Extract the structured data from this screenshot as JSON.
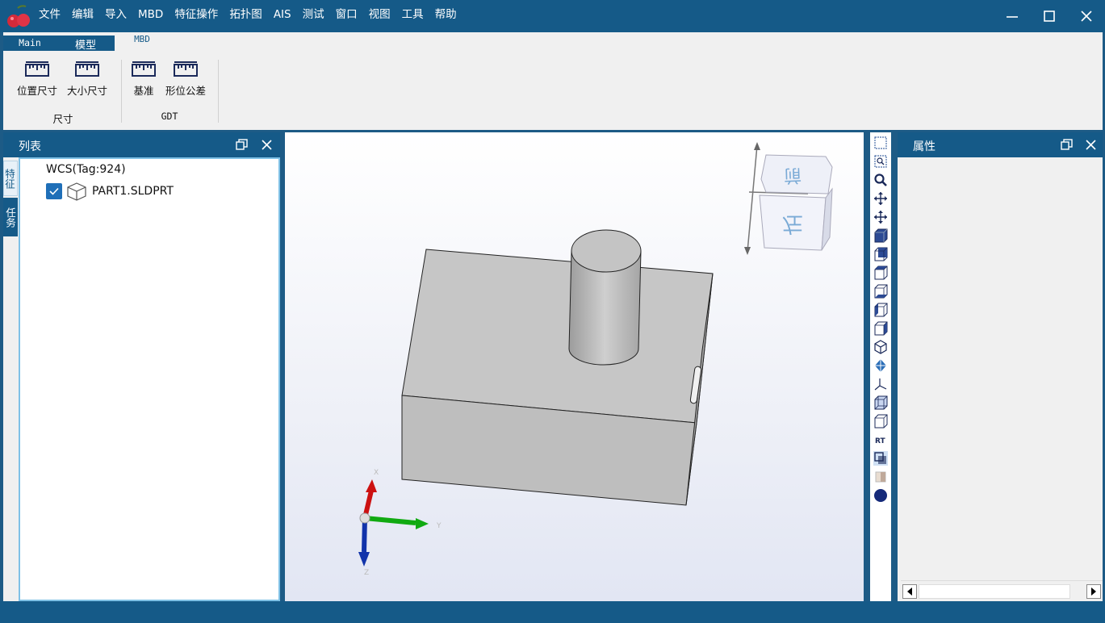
{
  "menu": [
    "文件",
    "编辑",
    "导入",
    "MBD",
    "特征操作",
    "拓扑图",
    "AIS",
    "测试",
    "窗口",
    "视图",
    "工具",
    "帮助"
  ],
  "tabs": {
    "main": "Main",
    "model": "模型",
    "mbd": "MBD"
  },
  "ribbon": {
    "buttons": [
      "位置尺寸",
      "大小尺寸",
      "基准",
      "形位公差"
    ],
    "groups": [
      "尺寸",
      "GDT"
    ]
  },
  "left_panel": {
    "title": "列表",
    "side_tabs": [
      "特征",
      "任务"
    ],
    "tree_root": "WCS(Tag:924)",
    "tree_item": "PART1.SLDPRT"
  },
  "right_panel": {
    "title": "属性"
  },
  "viewport": {
    "axis_labels": {
      "x": "X",
      "y": "Y",
      "z": "Z"
    },
    "toolbar_rt_label": "RT",
    "view_cube_faces": {
      "top": "前",
      "front": "左"
    }
  },
  "colors": {
    "primary": "#155a88",
    "axis_x": "#cc1111",
    "axis_y": "#11aa11",
    "axis_z": "#1133aa"
  }
}
